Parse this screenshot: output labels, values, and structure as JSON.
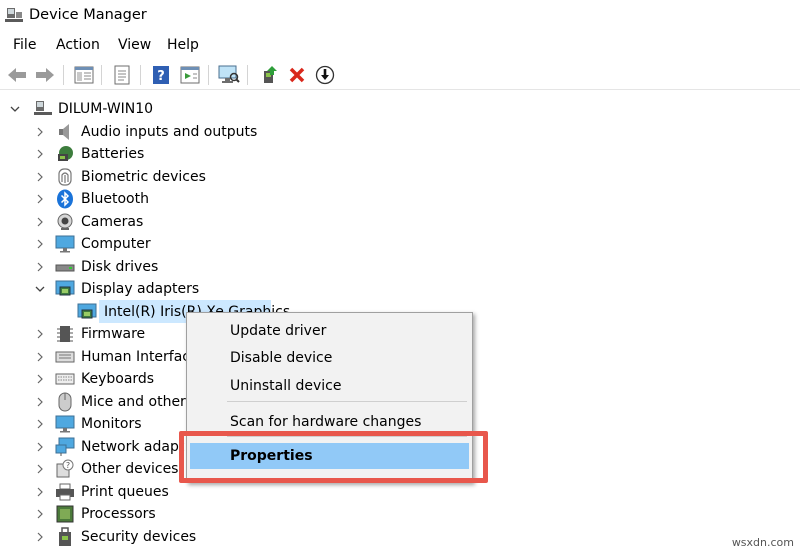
{
  "window": {
    "title": "Device Manager"
  },
  "menubar": {
    "items": [
      "File",
      "Action",
      "View",
      "Help"
    ]
  },
  "tree": {
    "computer": "DILUM-WIN10",
    "categories": [
      {
        "label": "Audio inputs and outputs",
        "icon": "speaker-icon",
        "expanded": false
      },
      {
        "label": "Batteries",
        "icon": "battery-icon",
        "expanded": false
      },
      {
        "label": "Biometric devices",
        "icon": "fingerprint-icon",
        "expanded": false
      },
      {
        "label": "Bluetooth",
        "icon": "bluetooth-icon",
        "expanded": false
      },
      {
        "label": "Cameras",
        "icon": "camera-icon",
        "expanded": false
      },
      {
        "label": "Computer",
        "icon": "monitor-icon",
        "expanded": false
      },
      {
        "label": "Disk drives",
        "icon": "disk-icon",
        "expanded": false
      },
      {
        "label": "Display adapters",
        "icon": "display-adapter-icon",
        "expanded": true
      },
      {
        "label": "Firmware",
        "icon": "chip-icon",
        "expanded": false
      },
      {
        "label": "Human Interface",
        "icon": "hid-icon",
        "expanded": false
      },
      {
        "label": "Keyboards",
        "icon": "keyboard-icon",
        "expanded": false
      },
      {
        "label": "Mice and other p",
        "icon": "mouse-icon",
        "expanded": false
      },
      {
        "label": "Monitors",
        "icon": "monitor-icon",
        "expanded": false
      },
      {
        "label": "Network adapt",
        "icon": "network-icon",
        "expanded": false
      },
      {
        "label": "Other devices",
        "icon": "unknown-device-icon",
        "expanded": false
      },
      {
        "label": "Print queues",
        "icon": "printer-icon",
        "expanded": false
      },
      {
        "label": "Processors",
        "icon": "processor-icon",
        "expanded": false
      },
      {
        "label": "Security devices",
        "icon": "security-icon",
        "expanded": false
      }
    ],
    "selected_device": "Intel(R) Iris(R) Xe Graphics"
  },
  "context_menu": {
    "items": [
      "Update driver",
      "Disable device",
      "Uninstall device",
      "Scan for hardware changes",
      "Properties"
    ],
    "highlighted": "Properties"
  },
  "watermark": "wsxdn.com",
  "colors": {
    "selection": "#cce8ff",
    "menu_highlight": "#91c9f7",
    "callout_border": "#e8574c",
    "delete_red": "#d9281c"
  }
}
